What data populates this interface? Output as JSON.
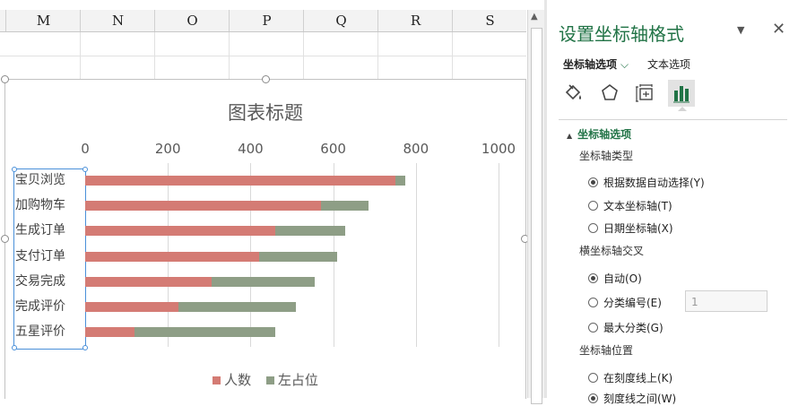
{
  "sheet": {
    "columns": [
      "M",
      "N",
      "O",
      "P",
      "Q",
      "R",
      "S"
    ]
  },
  "chart_data": {
    "type": "bar",
    "orientation": "horizontal",
    "stacked": true,
    "title": "图表标题",
    "categories": [
      "宝贝浏览",
      "加购物车",
      "生成订单",
      "支付订单",
      "交易完成",
      "完成评价",
      "五星评价"
    ],
    "series": [
      {
        "name": "人数",
        "color": "#d47b74",
        "values": [
          750,
          570,
          460,
          420,
          305,
          225,
          120
        ]
      },
      {
        "name": "左占位",
        "color": "#8e9e86",
        "values": [
          25,
          115,
          170,
          190,
          250,
          285,
          340
        ]
      }
    ],
    "xlim": [
      0,
      1000
    ],
    "xticks": [
      "0",
      "200",
      "400",
      "600",
      "800",
      "1000"
    ],
    "grid": true,
    "legend": "bottom"
  },
  "pane": {
    "title": "设置坐标轴格式",
    "tab_axis_options": "坐标轴选项",
    "tab_text_options": "文本选项",
    "section": "坐标轴选项",
    "axis_type_label": "坐标轴类型",
    "axis_type_options": [
      "根据数据自动选择(Y)",
      "文本坐标轴(T)",
      "日期坐标轴(X)"
    ],
    "cross_label": "横坐标轴交叉",
    "cross_options": [
      "自动(O)",
      "分类编号(E)",
      "最大分类(G)"
    ],
    "cross_number": "1",
    "position_label": "坐标轴位置",
    "position_options": [
      "在刻度线上(K)",
      "刻度线之间(W)"
    ]
  }
}
